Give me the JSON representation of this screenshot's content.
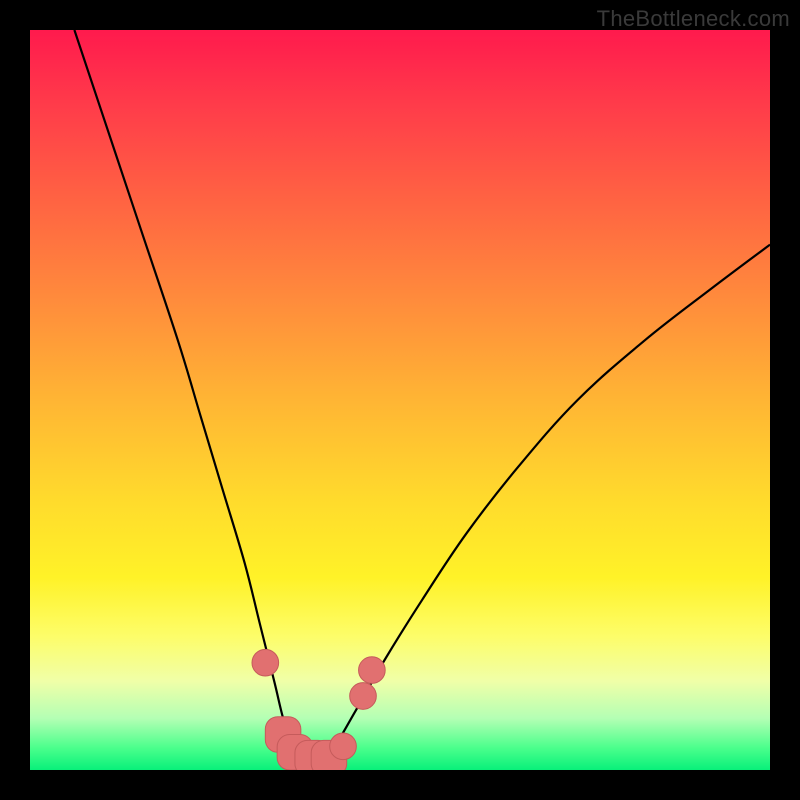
{
  "watermark": "TheBottleneck.com",
  "colors": {
    "background": "#000000",
    "curve": "#000000",
    "marker_fill": "#e17070",
    "marker_stroke": "#c55b5b",
    "gradient_top": "#ff1a4d",
    "gradient_bottom": "#08f07a"
  },
  "chart_data": {
    "type": "line",
    "title": "",
    "xlabel": "",
    "ylabel": "",
    "xlim": [
      0,
      100
    ],
    "ylim": [
      0,
      100
    ],
    "grid": false,
    "legend": false,
    "series": [
      {
        "name": "bottleneck-curve",
        "x": [
          6,
          10,
          15,
          20,
          23,
          26,
          29,
          31,
          33,
          34.5,
          36,
          37.5,
          39,
          41,
          44,
          48,
          53,
          59,
          66,
          74,
          83,
          92,
          100
        ],
        "y": [
          100,
          88,
          73,
          58,
          48,
          38,
          28,
          20,
          12,
          6,
          3,
          1.5,
          1.5,
          3,
          8,
          15,
          23,
          32,
          41,
          50,
          58,
          65,
          71
        ]
      }
    ],
    "markers": [
      {
        "shape": "circle",
        "x": 31.8,
        "y": 14.5,
        "size": 3.0
      },
      {
        "shape": "rounded-square",
        "x": 34.2,
        "y": 4.8,
        "size": 4.0
      },
      {
        "shape": "rounded-square",
        "x": 35.8,
        "y": 2.4,
        "size": 4.0
      },
      {
        "shape": "rounded-square",
        "x": 38.2,
        "y": 1.6,
        "size": 4.0
      },
      {
        "shape": "rounded-square",
        "x": 40.4,
        "y": 1.6,
        "size": 4.0
      },
      {
        "shape": "circle",
        "x": 42.3,
        "y": 3.2,
        "size": 3.0
      },
      {
        "shape": "circle",
        "x": 45.0,
        "y": 10.0,
        "size": 3.0
      },
      {
        "shape": "circle",
        "x": 46.2,
        "y": 13.5,
        "size": 3.0
      }
    ],
    "annotations": []
  }
}
